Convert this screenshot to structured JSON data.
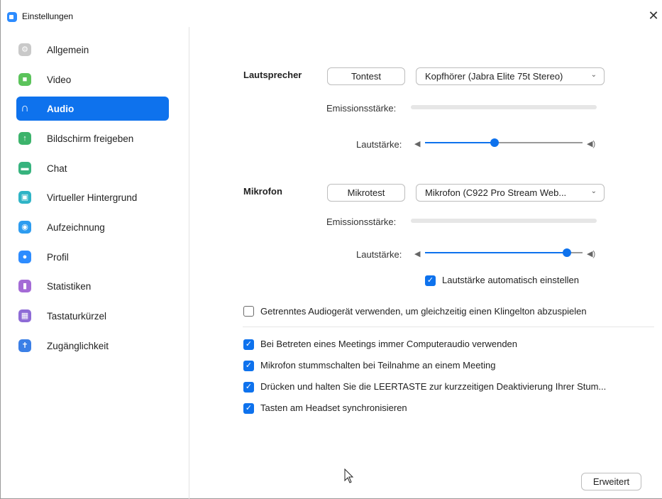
{
  "window": {
    "title": "Einstellungen",
    "close_label": "✕"
  },
  "sidebar": {
    "items": [
      {
        "label": "Allgemein",
        "icon": "gear-icon",
        "color": "#c9c9c9",
        "glyph": "⚙"
      },
      {
        "label": "Video",
        "icon": "video-camera-icon",
        "color": "#5bc35b",
        "glyph": "■"
      },
      {
        "label": "Audio",
        "icon": "headphones-icon",
        "color": "#0e72ed",
        "glyph": "∩",
        "active": true
      },
      {
        "label": "Bildschirm freigeben",
        "icon": "share-screen-icon",
        "color": "#3cb36b",
        "glyph": "↑"
      },
      {
        "label": "Chat",
        "icon": "chat-bubble-icon",
        "color": "#37b37e",
        "glyph": "▬"
      },
      {
        "label": "Virtueller Hintergrund",
        "icon": "virtual-background-icon",
        "color": "#2fb4c6",
        "glyph": "▣"
      },
      {
        "label": "Aufzeichnung",
        "icon": "record-icon",
        "color": "#2d9cf0",
        "glyph": "◉"
      },
      {
        "label": "Profil",
        "icon": "profile-icon",
        "color": "#2d8cff",
        "glyph": "●"
      },
      {
        "label": "Statistiken",
        "icon": "statistics-icon",
        "color": "#a46bd6",
        "glyph": "▮"
      },
      {
        "label": "Tastaturkürzel",
        "icon": "keyboard-icon",
        "color": "#8e6bd6",
        "glyph": "▦"
      },
      {
        "label": "Zugänglichkeit",
        "icon": "accessibility-icon",
        "color": "#3b7fe6",
        "glyph": "✝"
      }
    ]
  },
  "speaker": {
    "heading": "Lautsprecher",
    "test_button": "Tontest",
    "device": "Kopfhörer (Jabra Elite 75t Stereo)",
    "level_label": "Emissionsstärke:",
    "volume_label": "Lautstärke:",
    "volume": 0.44
  },
  "microphone": {
    "heading": "Mikrofon",
    "test_button": "Mikrotest",
    "device": "Mikrofon (C922 Pro Stream Web...",
    "level_label": "Emissionsstärke:",
    "volume_label": "Lautstärke:",
    "volume": 0.9,
    "auto_adjust_label": "Lautstärke automatisch einstellen",
    "auto_adjust": true
  },
  "options": {
    "separate_device": {
      "label": "Getrenntes Audiogerät verwenden, um gleichzeitig einen Klingelton abzuspielen",
      "checked": false
    },
    "computer_audio": {
      "label": "Bei Betreten eines Meetings immer Computeraudio verwenden",
      "checked": true
    },
    "mute_on_join": {
      "label": "Mikrofon stummschalten bei Teilnahme an einem Meeting",
      "checked": true
    },
    "push_to_talk": {
      "label": "Drücken und halten Sie die LEERTASTE zur kurzzeitigen Deaktivierung Ihrer Stum...",
      "checked": true
    },
    "headset_sync": {
      "label": "Tasten am Headset synchronisieren",
      "checked": true
    }
  },
  "advanced_button": "Erweitert",
  "colors": {
    "accent": "#0e72ed",
    "track": "#9a9a9a",
    "meter": "#e6e6e6"
  }
}
